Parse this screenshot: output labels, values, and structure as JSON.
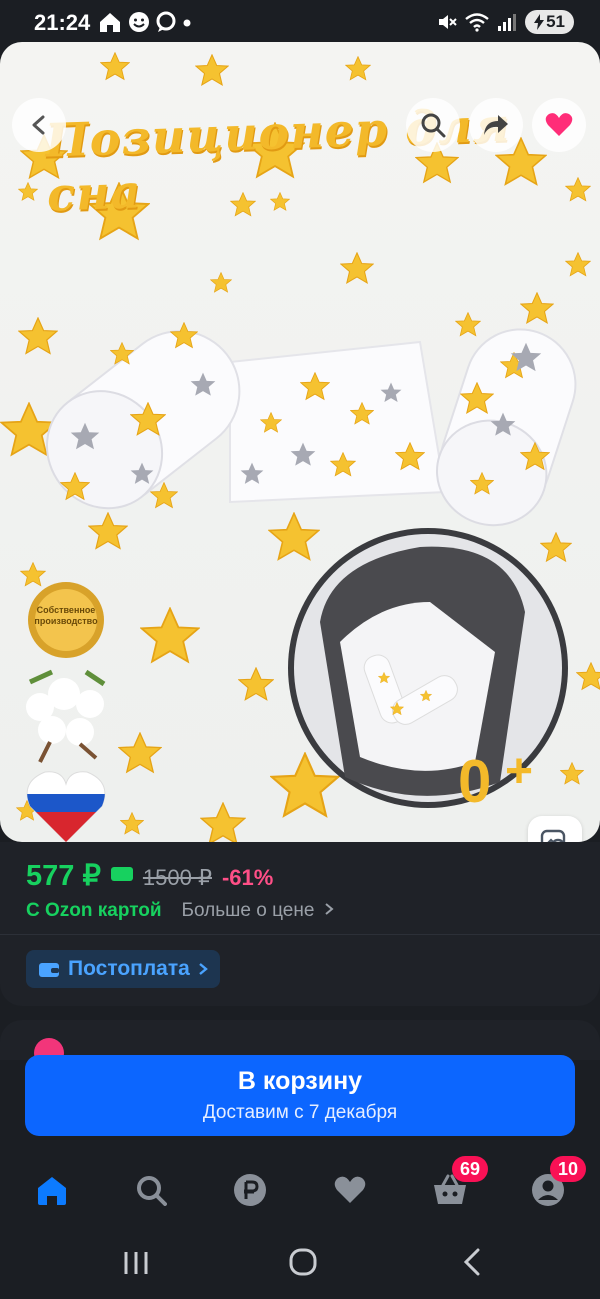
{
  "status": {
    "time": "21:24",
    "battery": "51",
    "icons": [
      "home-status-icon",
      "face-status-icon",
      "chat-status-icon",
      "mute-icon",
      "wifi-icon",
      "signal-icon",
      "battery-icon"
    ]
  },
  "product": {
    "image_title": "Позиционер для сна",
    "badge_text": "Собственное производство",
    "price_current": "577 ₽",
    "price_old": "1500 ₽",
    "discount": "-61%",
    "ozon_card_label": "С Ozon картой",
    "more_price_label": "Больше о цене"
  },
  "postpay": {
    "label": "Постоплата"
  },
  "cart": {
    "button_label": "В корзину",
    "delivery_text": "Доставим с 7 декабря"
  },
  "tabs": {
    "cart_badge": "69",
    "profile_badge": "10"
  },
  "colors": {
    "background": "#1b1e23",
    "price_green": "#17d15f",
    "discount_pink": "#ff4f87",
    "primary_blue": "#0c66ff",
    "badge_red": "#f91155"
  }
}
